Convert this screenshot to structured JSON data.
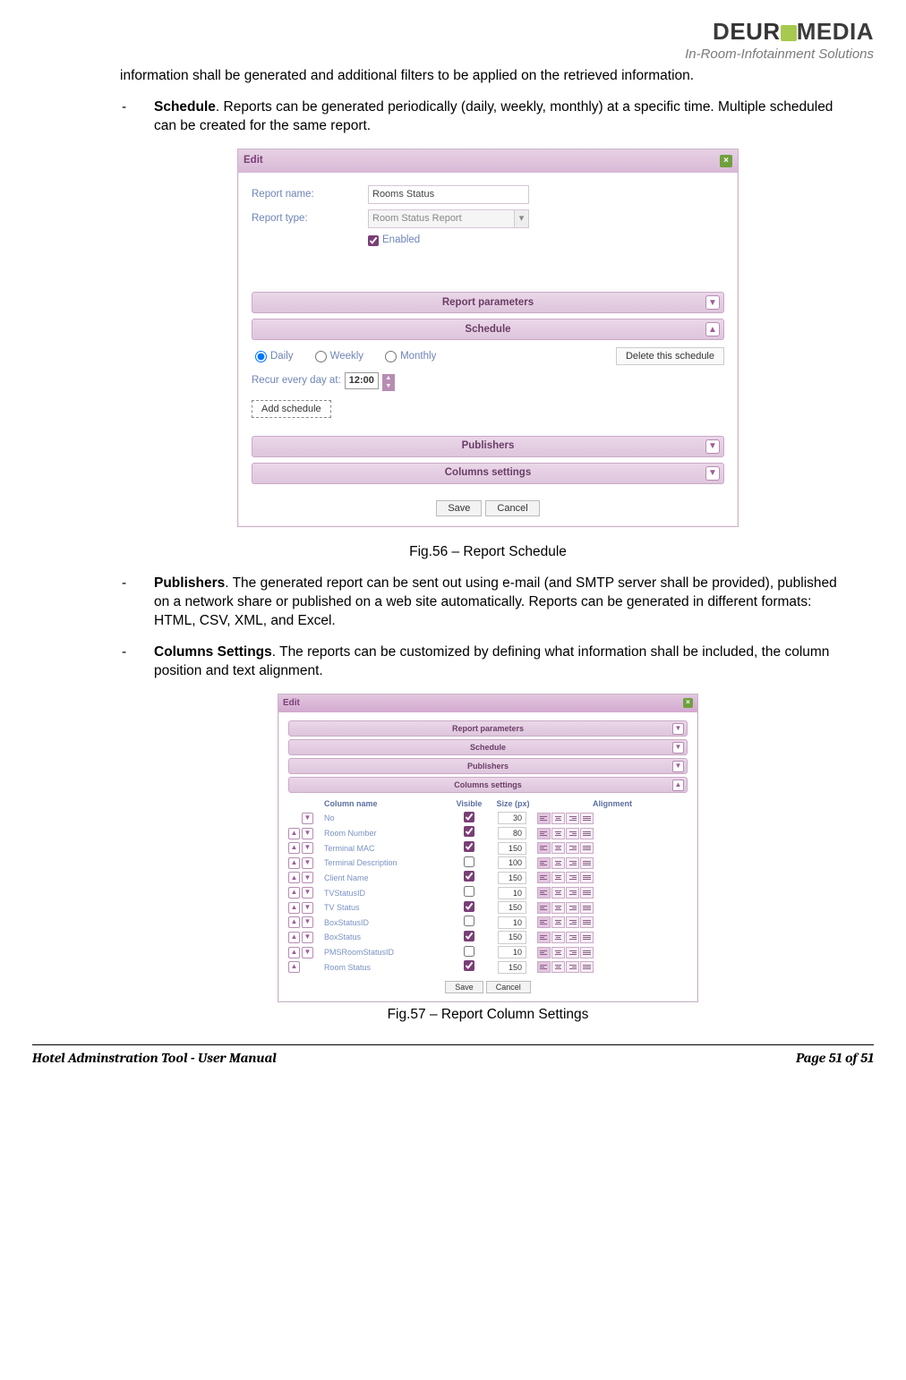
{
  "brand": {
    "main": "DEUROMEDIA",
    "sub": "In-Room-Infotainment Solutions"
  },
  "intro": "information shall be generated and additional filters to be applied on the retrieved information.",
  "b_schedule": {
    "title": "Schedule",
    "text": ". Reports can be generated periodically (daily, weekly, monthly) at a specific time. Multiple scheduled can be created for the same report."
  },
  "fig56": {
    "caption": "Fig.56 – Report Schedule",
    "window_title": "Edit",
    "rn_label": "Report name:",
    "rn_value": "Rooms Status",
    "rt_label": "Report type:",
    "rt_value": "Room Status Report",
    "enabled": "Enabled",
    "sec_params": "Report parameters",
    "sec_sched": "Schedule",
    "daily": "Daily",
    "weekly": "Weekly",
    "monthly": "Monthly",
    "delete": "Delete this schedule",
    "recur": "Recur every day at:",
    "time": "12:00",
    "add": "Add schedule",
    "sec_pub": "Publishers",
    "sec_cols": "Columns settings",
    "save": "Save",
    "cancel": "Cancel"
  },
  "b_publishers": {
    "title": "Publishers",
    "text": ". The generated report can be sent out using e-mail (and SMTP server shall be provided), published on a network share or published on a web site automatically. Reports can be generated in different formats: HTML, CSV, XML, and Excel."
  },
  "b_columns": {
    "title": "Columns Settings",
    "text": ". The reports can be customized by defining what information shall be included, the column position and text alignment."
  },
  "fig57": {
    "caption": "Fig.57 – Report Column Settings",
    "window_title": "Edit",
    "sec_params": "Report parameters",
    "sec_sched": "Schedule",
    "sec_pub": "Publishers",
    "sec_cols": "Columns settings",
    "hdr_name": "Column name",
    "hdr_vis": "Visible",
    "hdr_size": "Size (px)",
    "hdr_align": "Alignment",
    "rows": [
      {
        "up": false,
        "down": true,
        "name": "No",
        "vis": true,
        "size": "30",
        "align": 0
      },
      {
        "up": true,
        "down": true,
        "name": "Room Number",
        "vis": true,
        "size": "80",
        "align": 0
      },
      {
        "up": true,
        "down": true,
        "name": "Terminal MAC",
        "vis": true,
        "size": "150",
        "align": 0
      },
      {
        "up": true,
        "down": true,
        "name": "Terminal Description",
        "vis": false,
        "size": "100",
        "align": 0
      },
      {
        "up": true,
        "down": true,
        "name": "Client Name",
        "vis": true,
        "size": "150",
        "align": 0
      },
      {
        "up": true,
        "down": true,
        "name": "TVStatusID",
        "vis": false,
        "size": "10",
        "align": 0
      },
      {
        "up": true,
        "down": true,
        "name": "TV Status",
        "vis": true,
        "size": "150",
        "align": 0
      },
      {
        "up": true,
        "down": true,
        "name": "BoxStatusID",
        "vis": false,
        "size": "10",
        "align": 0
      },
      {
        "up": true,
        "down": true,
        "name": "BoxStatus",
        "vis": true,
        "size": "150",
        "align": 0
      },
      {
        "up": true,
        "down": true,
        "name": "PMSRoomStatusID",
        "vis": false,
        "size": "10",
        "align": 0
      },
      {
        "up": true,
        "down": false,
        "name": "Room Status",
        "vis": true,
        "size": "150",
        "align": 0
      }
    ],
    "save": "Save",
    "cancel": "Cancel"
  },
  "footer": {
    "left": "Hotel Adminstration Tool - User Manual",
    "right": "Page 51 of 51"
  }
}
